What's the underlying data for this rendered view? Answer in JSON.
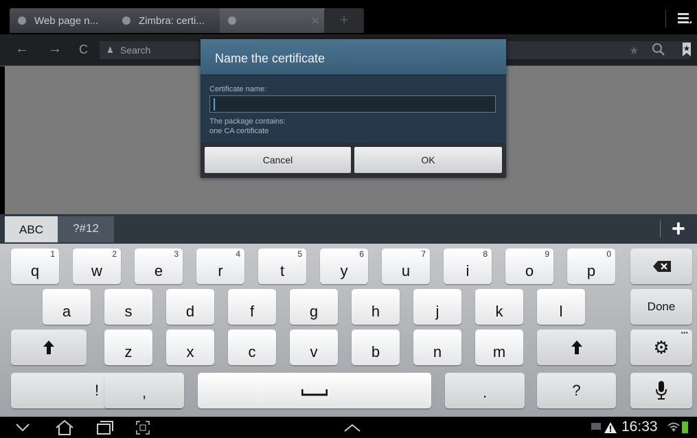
{
  "browser": {
    "tabs": [
      {
        "label": "Web page n..."
      },
      {
        "label": "Zimbra: certi..."
      },
      {
        "label": ""
      }
    ],
    "search_placeholder": "Search"
  },
  "dialog": {
    "title": "Name the certificate",
    "field_label": "Certificate name:",
    "field_value": "",
    "package_line1": "The package contains:",
    "package_line2": "one CA certificate",
    "cancel_label": "Cancel",
    "ok_label": "OK"
  },
  "keyboard": {
    "mode_abc": "ABC",
    "mode_symbols": "?#12",
    "row1": [
      {
        "k": "q",
        "n": "1"
      },
      {
        "k": "w",
        "n": "2"
      },
      {
        "k": "e",
        "n": "3"
      },
      {
        "k": "r",
        "n": "4"
      },
      {
        "k": "t",
        "n": "5"
      },
      {
        "k": "y",
        "n": "6"
      },
      {
        "k": "u",
        "n": "7"
      },
      {
        "k": "i",
        "n": "8"
      },
      {
        "k": "o",
        "n": "9"
      },
      {
        "k": "p",
        "n": "0"
      }
    ],
    "row2": [
      "a",
      "s",
      "d",
      "f",
      "g",
      "h",
      "j",
      "k",
      "l"
    ],
    "row3": [
      "z",
      "x",
      "c",
      "v",
      "b",
      "n",
      "m"
    ],
    "done_label": "Done",
    "exclaim": "!",
    "comma": ",",
    "period": ".",
    "question": "?"
  },
  "status": {
    "time": "16:33"
  }
}
